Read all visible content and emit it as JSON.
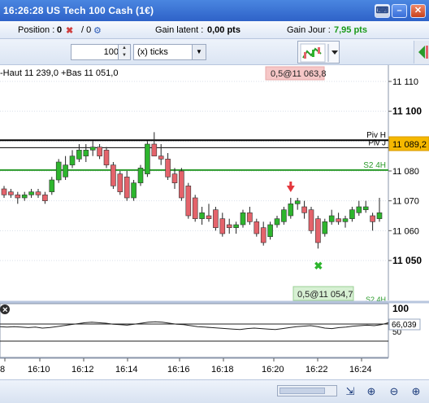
{
  "window": {
    "title": "16:26:28 US Tech 100 Cash (1€)"
  },
  "infobar": {
    "position_label": "Position :",
    "position_value": "0",
    "ratio_value": "/ 0",
    "latent_label": "Gain latent :",
    "latent_value": "0,00 pts",
    "day_label": "Gain Jour :",
    "day_value": "7,95 pts",
    "day_color": "#1a9a1a"
  },
  "toolbar": {
    "quantity": "100",
    "mode": "(x) ticks"
  },
  "chart": {
    "highlow_text": "-Haut 11 239,0 +Bas 11 051,0",
    "top_label": "0,5@11 063,8",
    "bottom_label": "0,5@11 054,7",
    "price_tag": "11 089,2",
    "line_labels": {
      "piv_h": "Piv H",
      "piv_j": "Piv J",
      "s2": "S2 4H",
      "s2_4h_cut": "S2 4H"
    },
    "colors": {
      "up": "#2db52d",
      "down": "#e4636b",
      "s2": "#2a9a2a",
      "grid": "#d8dfe9"
    },
    "y_axis": [
      "11 110",
      "11 100",
      "11 090",
      "11 080",
      "11 070",
      "11 060",
      "11 050"
    ],
    "x_axis": [
      "8",
      "16:10",
      "16:12",
      "16:14",
      "16:16",
      "16:18",
      "16:20",
      "16:22",
      "16:24"
    ],
    "oscillator": {
      "top_label": "100",
      "mid_label": "50",
      "value": "66,039"
    }
  },
  "chart_data": {
    "type": "candlestick",
    "title": "US Tech 100 Cash (1€)",
    "y_unit": "points",
    "ylim": [
      11046,
      11112
    ],
    "levels": {
      "piv_h": 11090.3,
      "piv_j": 11087.8,
      "s2_4h": 11080.3,
      "last": 11089.2
    },
    "ohlc": [
      [
        11074,
        11075,
        11071,
        11072
      ],
      [
        11073,
        11074,
        11071,
        11072
      ],
      [
        11072,
        11073,
        11069,
        11071
      ],
      [
        11071,
        11073,
        11070,
        11072
      ],
      [
        11072,
        11074,
        11071,
        11073
      ],
      [
        11073,
        11074,
        11071,
        11072
      ],
      [
        11072,
        11073,
        11069,
        11070
      ],
      [
        11073,
        11078,
        11072,
        11077
      ],
      [
        11077,
        11084,
        11076,
        11083
      ],
      [
        11078,
        11085,
        11077,
        11082
      ],
      [
        11082,
        11087,
        11081,
        11085
      ],
      [
        11084,
        11089,
        11083,
        11087
      ],
      [
        11085,
        11089,
        11083,
        11087
      ],
      [
        11087,
        11090,
        11085,
        11088
      ],
      [
        11088,
        11089,
        11084,
        11085
      ],
      [
        11087,
        11088,
        11081,
        11082
      ],
      [
        11082,
        11083,
        11074,
        11075
      ],
      [
        11079,
        11080,
        11072,
        11073
      ],
      [
        11078,
        11080,
        11070,
        11071
      ],
      [
        11071,
        11077,
        11070,
        11076
      ],
      [
        11076,
        11082,
        11075,
        11081
      ],
      [
        11079,
        11090,
        11078,
        11089
      ],
      [
        11089,
        11093,
        11085,
        11085
      ],
      [
        11085,
        11089,
        11082,
        11084
      ],
      [
        11084,
        11086,
        11077,
        11078
      ],
      [
        11079,
        11081,
        11074,
        11076
      ],
      [
        11080,
        11081,
        11070,
        11071
      ],
      [
        11075,
        11076,
        11064,
        11065
      ],
      [
        11071,
        11072,
        11063,
        11064
      ],
      [
        11064,
        11068,
        11062,
        11066
      ],
      [
        11065,
        11069,
        11063,
        11064
      ],
      [
        11067,
        11068,
        11060,
        11061
      ],
      [
        11064,
        11066,
        11058,
        11059
      ],
      [
        11062,
        11064,
        11059,
        11061
      ],
      [
        11061,
        11063,
        11059,
        11062
      ],
      [
        11062,
        11067,
        11061,
        11066
      ],
      [
        11066,
        11068,
        11062,
        11063
      ],
      [
        11063,
        11064,
        11058,
        11059
      ],
      [
        11061,
        11063,
        11055,
        11056
      ],
      [
        11058,
        11063,
        11057,
        11062
      ],
      [
        11062,
        11065,
        11061,
        11064
      ],
      [
        11063,
        11068,
        11062,
        11067
      ],
      [
        11065,
        11071,
        11064,
        11069
      ],
      [
        11069,
        11071,
        11067,
        11070
      ],
      [
        11068,
        11070,
        11064,
        11066
      ],
      [
        11067,
        11068,
        11059,
        11060
      ],
      [
        11064,
        11065,
        11054,
        11056
      ],
      [
        11059,
        11064,
        11058,
        11063
      ],
      [
        11063,
        11067,
        11062,
        11065
      ],
      [
        11064,
        11066,
        11062,
        11063
      ],
      [
        11063,
        11065,
        11061,
        11064
      ],
      [
        11064,
        11068,
        11063,
        11067
      ],
      [
        11066,
        11070,
        11065,
        11068
      ],
      [
        11067,
        11070,
        11066,
        11068
      ],
      [
        11065,
        11066,
        11060,
        11063
      ],
      [
        11064,
        11071,
        11063,
        11066
      ]
    ],
    "oscillator_ylim": [
      0,
      100
    ],
    "oscillator_values": [
      58,
      57,
      58,
      57,
      56,
      57,
      55,
      56,
      58,
      60,
      62,
      64,
      66,
      67,
      66,
      65,
      63,
      62,
      61,
      63,
      65,
      67,
      68,
      67,
      65,
      63,
      62,
      60,
      58,
      57,
      56,
      55,
      54,
      53,
      52,
      54,
      55,
      54,
      53,
      52,
      54,
      56,
      58,
      59,
      60,
      58,
      55,
      54,
      56,
      57,
      59,
      60,
      61,
      60,
      62,
      66
    ]
  },
  "bottombar": {}
}
